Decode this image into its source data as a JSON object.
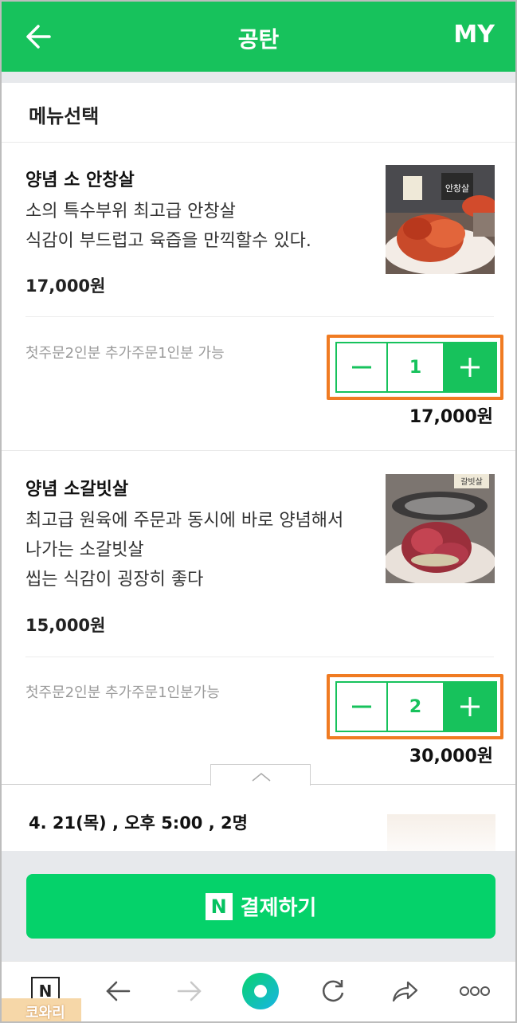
{
  "header": {
    "title": "공탄",
    "right_label": "MY"
  },
  "section_title": "메뉴선택",
  "menu_items": [
    {
      "name": "양념 소 안창살",
      "desc": [
        "소의 특수부위 최고급 안창살",
        "식감이 부드럽고 육즙을 만끽할수 있다."
      ],
      "price": "17,000원",
      "note": "첫주문2인분 추가주문1인분 가능",
      "qty": "1",
      "subtotal": "17,000원",
      "thumb_sign": "안창살"
    },
    {
      "name": "양념 소갈빗살",
      "desc": [
        "최고급 원육에 주문과 동시에 바로 양념해서",
        "나가는 소갈빗살",
        "씹는 식감이 굉장히 좋다"
      ],
      "price": "15,000원",
      "note": "첫주문2인분 추가주문1인분가능",
      "qty": "2",
      "subtotal": "30,000원",
      "thumb_sign": "갈빗살"
    }
  ],
  "summary": {
    "text": "4. 21(목) , 오후 5:00 , 2명"
  },
  "pay_button": {
    "badge": "N",
    "label": "결제하기"
  },
  "browser_bar": {
    "home_badge": "N"
  },
  "watermark": "코와리",
  "colors": {
    "brand_green": "#17c25c",
    "pay_green": "#05d26a",
    "highlight_orange": "#f07b22"
  }
}
